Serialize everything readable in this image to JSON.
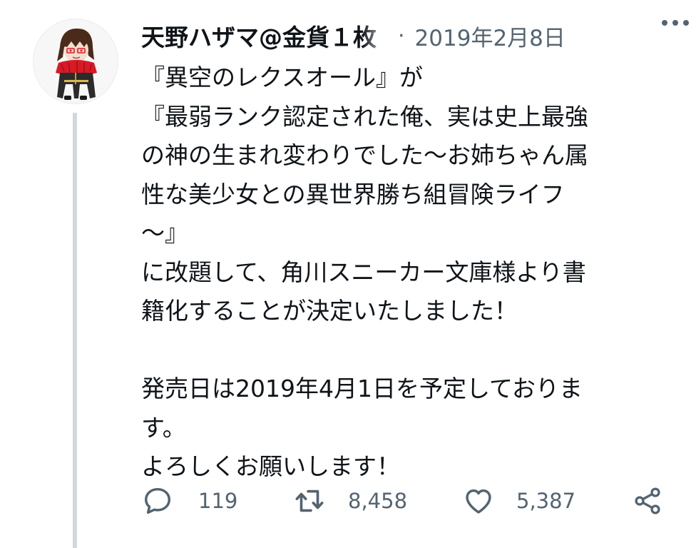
{
  "tweet": {
    "author_name": "天野ハザマ@金貨１枚",
    "separator": "·",
    "date": "2019年2月8日",
    "text_lines": [
      "『異空のレクスオール』が",
      "『最弱ランク認定された俺、実は史上最強",
      "の神の生まれ変わりでした〜お姉ちゃん属",
      "性な美少女との異世界勝ち組冒険ライフ",
      "〜』",
      "に改題して、角川スニーカー文庫様より書",
      "籍化することが決定いたしました！",
      "",
      "発売日は2019年4月1日を予定しておりま",
      "す。",
      "よろしくお願いします！"
    ]
  },
  "actions": {
    "reply": {
      "icon": "reply-icon",
      "count": "119"
    },
    "retweet": {
      "icon": "retweet-icon",
      "count": "8,458"
    },
    "like": {
      "icon": "heart-icon",
      "count": "5,387"
    },
    "share": {
      "icon": "share-icon"
    }
  },
  "colors": {
    "text": "#0f1419",
    "secondary": "#536471",
    "thread_line": "#cfd9de",
    "avatar_hair": "#4a2a1a",
    "avatar_scarf": "#d81a26",
    "avatar_coat": "#2b2b2b",
    "avatar_eyes": "#e0283a"
  }
}
